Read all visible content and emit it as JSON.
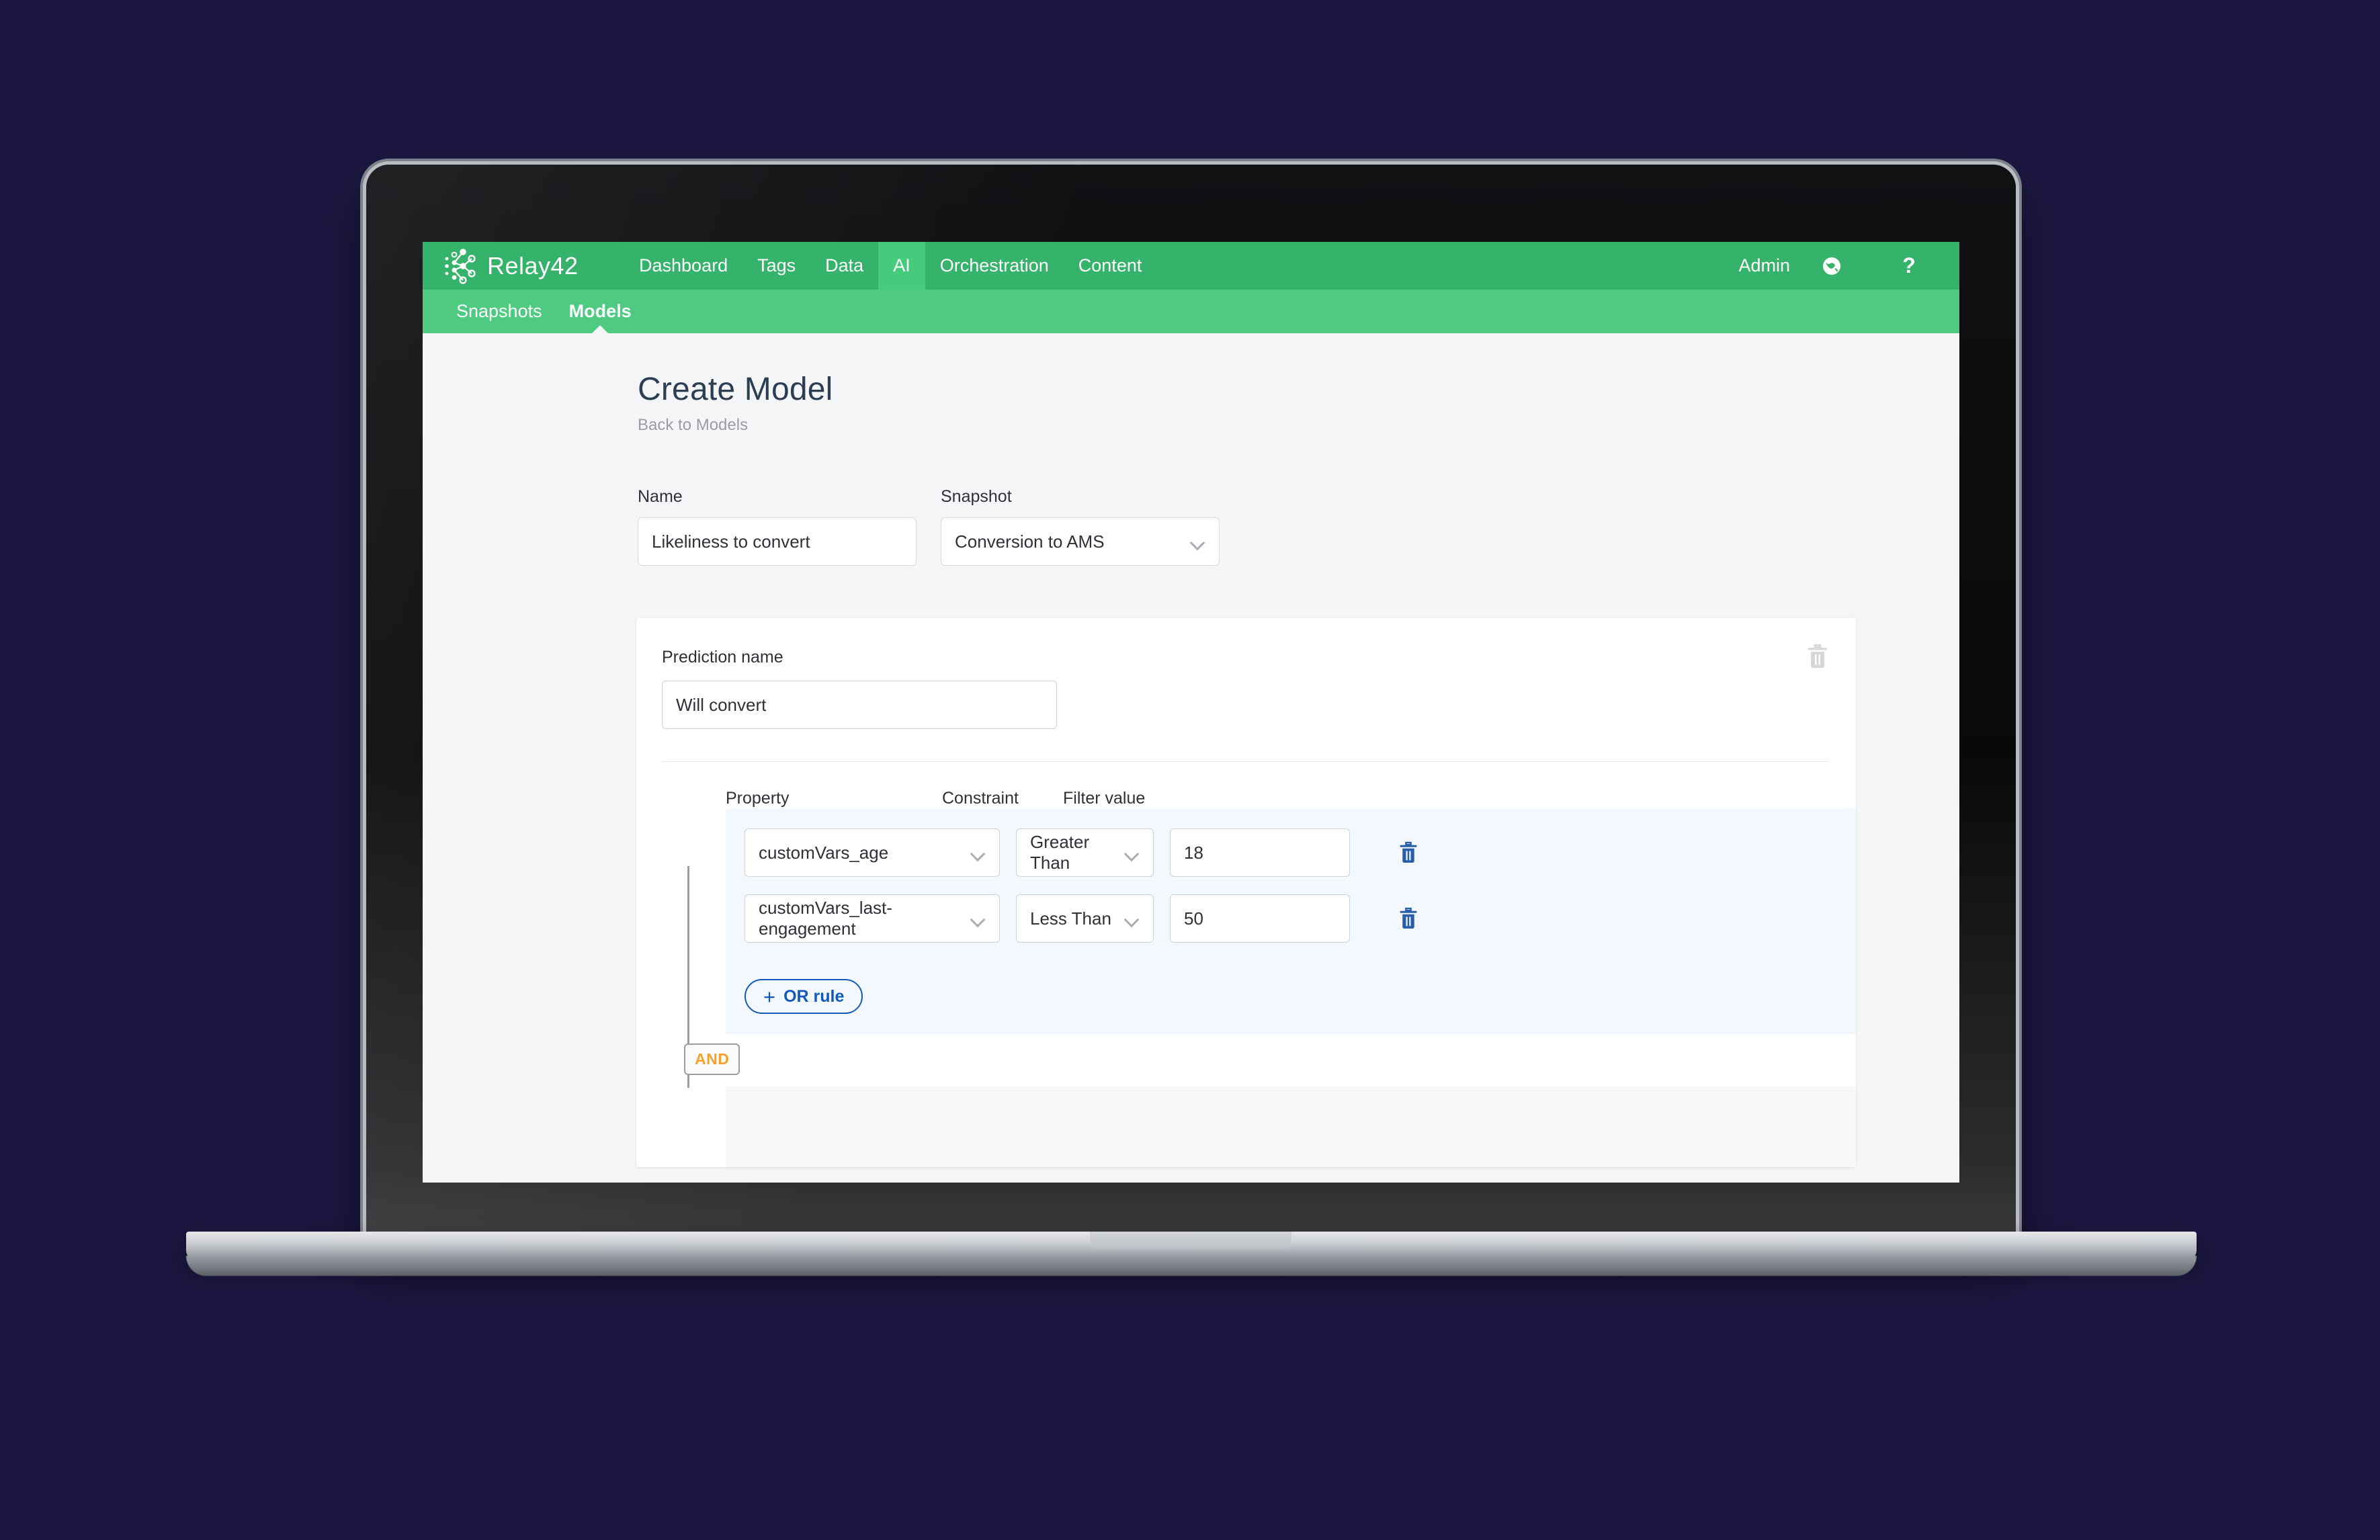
{
  "brand": {
    "name": "Relay42",
    "logo_icon": "relay42-dots-logo"
  },
  "topnav": {
    "items": [
      {
        "label": "Dashboard",
        "active": false
      },
      {
        "label": "Tags",
        "active": false
      },
      {
        "label": "Data",
        "active": false
      },
      {
        "label": "AI",
        "active": true
      },
      {
        "label": "Orchestration",
        "active": false
      },
      {
        "label": "Content",
        "active": false
      }
    ],
    "admin_label": "Admin",
    "globe_icon": "globe-icon",
    "help_label": "?"
  },
  "subnav": {
    "items": [
      {
        "label": "Snapshots",
        "active": false
      },
      {
        "label": "Models",
        "active": true
      }
    ]
  },
  "page": {
    "title": "Create Model",
    "back_link": "Back to Models"
  },
  "form": {
    "name": {
      "label": "Name",
      "value": "Likeliness to convert"
    },
    "snapshot": {
      "label": "Snapshot",
      "value": "Conversion to AMS",
      "caret_icon": "chevron-down-icon"
    }
  },
  "prediction": {
    "label": "Prediction name",
    "value": "Will convert",
    "delete_icon": "trash-icon"
  },
  "rules": {
    "headers": {
      "property": "Property",
      "constraint": "Constraint",
      "filter_value": "Filter value"
    },
    "rows": [
      {
        "property": "customVars_age",
        "constraint": "Greater Than",
        "value": "18",
        "delete_icon": "trash-icon"
      },
      {
        "property": "customVars_last-engagement",
        "constraint": "Less Than",
        "value": "50",
        "delete_icon": "trash-icon"
      }
    ],
    "or_button": {
      "plus": "+",
      "label": "OR rule"
    },
    "and_connector": "AND"
  },
  "colors": {
    "brand_green": "#35b36a",
    "subnav_green": "#4ecb81",
    "nav_active_green": "#44cb7c",
    "title_navy": "#2c3e52",
    "accent_blue": "#1459b8",
    "and_orange": "#f5a22c",
    "group_bg": "#f2f8fd",
    "page_bg": "#f4f5f6",
    "backdrop": "#1b1740"
  }
}
